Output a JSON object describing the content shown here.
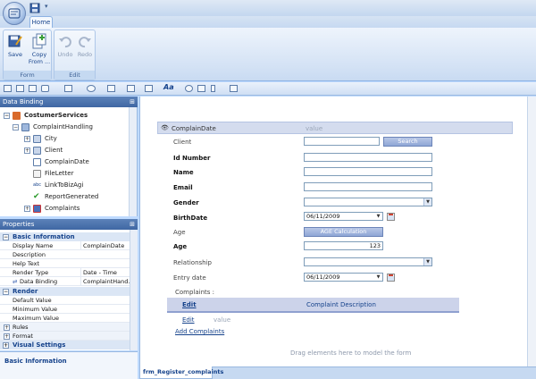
{
  "quick_access": {
    "save_icon": "save-icon",
    "customize_icon": "dropdown-arrow-icon"
  },
  "tabs": [
    {
      "label": "Home"
    }
  ],
  "ribbon": {
    "groups": [
      {
        "label": "Form",
        "buttons": [
          {
            "label": "Save",
            "icon": "save-icon"
          },
          {
            "label": "Copy From ...",
            "icon": "copy-icon"
          }
        ]
      },
      {
        "label": "Edit",
        "buttons": [
          {
            "label": "Undo",
            "icon": "undo-icon",
            "enabled": false
          },
          {
            "label": "Redo",
            "icon": "redo-icon",
            "enabled": false
          }
        ]
      }
    ]
  },
  "data_binding": {
    "title": "Data Binding",
    "root": "CostumerServices",
    "entity": "ComplaintHandling",
    "items": [
      {
        "label": "City",
        "icon": "entity-icon",
        "expandable": true
      },
      {
        "label": "Client",
        "icon": "entity-icon",
        "expandable": true
      },
      {
        "label": "ComplainDate",
        "icon": "date-icon",
        "expandable": false
      },
      {
        "label": "FileLetter",
        "icon": "file-icon",
        "expandable": false
      },
      {
        "label": "LinkToBizAgi",
        "icon": "text-abc-icon",
        "expandable": false
      },
      {
        "label": "ReportGenerated",
        "icon": "checkmark-icon",
        "expandable": false
      },
      {
        "label": "Complaints",
        "icon": "collection-icon",
        "expandable": true
      }
    ]
  },
  "properties": {
    "title": "Properties",
    "categories": [
      {
        "name": "Basic Information",
        "rows": [
          {
            "name": "Display Name",
            "value": "ComplainDate"
          },
          {
            "name": "Description",
            "value": ""
          },
          {
            "name": "Help Text",
            "value": ""
          },
          {
            "name": "Render Type",
            "value": "Date - Time"
          },
          {
            "name": "Data Binding",
            "value": "ComplaintHand..."
          }
        ]
      },
      {
        "name": "Render",
        "rows": [
          {
            "name": "Default Value",
            "value": ""
          },
          {
            "name": "Minimum Value",
            "value": ""
          },
          {
            "name": "Maximum Value",
            "value": ""
          },
          {
            "name": "Rules",
            "value": ""
          },
          {
            "name": "Format",
            "value": ""
          }
        ]
      },
      {
        "name": "Visual Settings",
        "rows": []
      }
    ],
    "description_title": "Basic Information"
  },
  "form": {
    "selected_field": {
      "label": "ComplainDate",
      "value": "value"
    },
    "client_label": "Client",
    "search_button": "Search",
    "id_label": "Id Number",
    "name_label": "Name",
    "email_label": "Email",
    "gender_label": "Gender",
    "birthdate_label": "BirthDate",
    "birthdate_value": "06/11/2009",
    "age_calc_label": "Age",
    "age_calc_button": "AGE Calculation",
    "age_label": "Age",
    "age_value": "123",
    "relationship_label": "Relationship",
    "entry_label": "Entry date",
    "entry_value": "06/11/2009",
    "complaints_label": "Complaints :",
    "grid_columns": [
      "Edit",
      "Complaint Description"
    ],
    "grid_row": {
      "edit": "Edit",
      "value": "value"
    },
    "add_link": "Add Complaints",
    "drop_hint": "Drag elements here to model the form"
  },
  "document_tab": "frm_Register_complaints"
}
